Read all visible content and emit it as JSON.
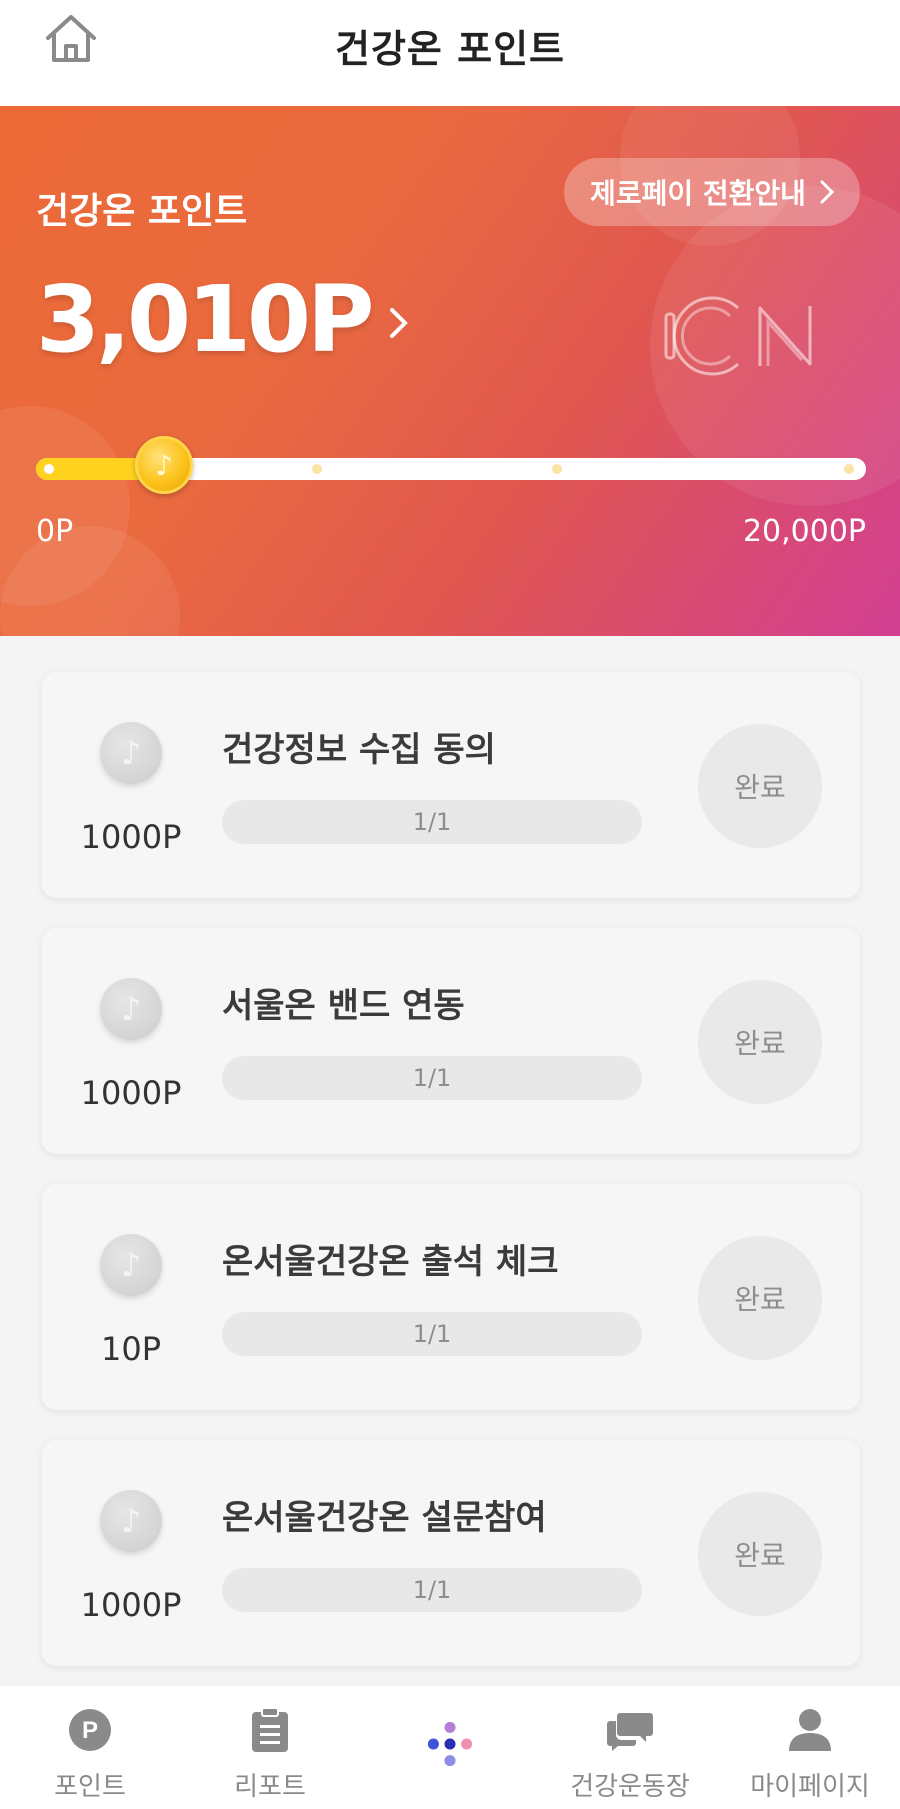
{
  "header": {
    "title": "건강온 포인트",
    "home_icon": "home-icon"
  },
  "hero": {
    "label": "건강온 포인트",
    "convert_button": "제로페이 전환안내",
    "points": "3,010P",
    "min_label": "0P",
    "max_label": "20,000P",
    "progress_fraction": 0.15,
    "logo": "ON",
    "gradient_colors": [
      "#ec6a37",
      "#d23f93"
    ]
  },
  "missions": [
    {
      "title": "건강정보 수집 동의",
      "points": "1000P",
      "progress": "1/1",
      "status": "완료"
    },
    {
      "title": "서울온 밴드 연동",
      "points": "1000P",
      "progress": "1/1",
      "status": "완료"
    },
    {
      "title": "온서울건강온 출석 체크",
      "points": "10P",
      "progress": "1/1",
      "status": "완료"
    },
    {
      "title": "온서울건강온 설문참여",
      "points": "1000P",
      "progress": "1/1",
      "status": "완료"
    }
  ],
  "bottom_nav": [
    {
      "label": "포인트",
      "icon": "points-p-icon"
    },
    {
      "label": "리포트",
      "icon": "clipboard-icon"
    },
    {
      "label": "",
      "icon": "dots-home-icon"
    },
    {
      "label": "건강운동장",
      "icon": "chat-bubbles-icon"
    },
    {
      "label": "마이페이지",
      "icon": "person-icon"
    }
  ]
}
